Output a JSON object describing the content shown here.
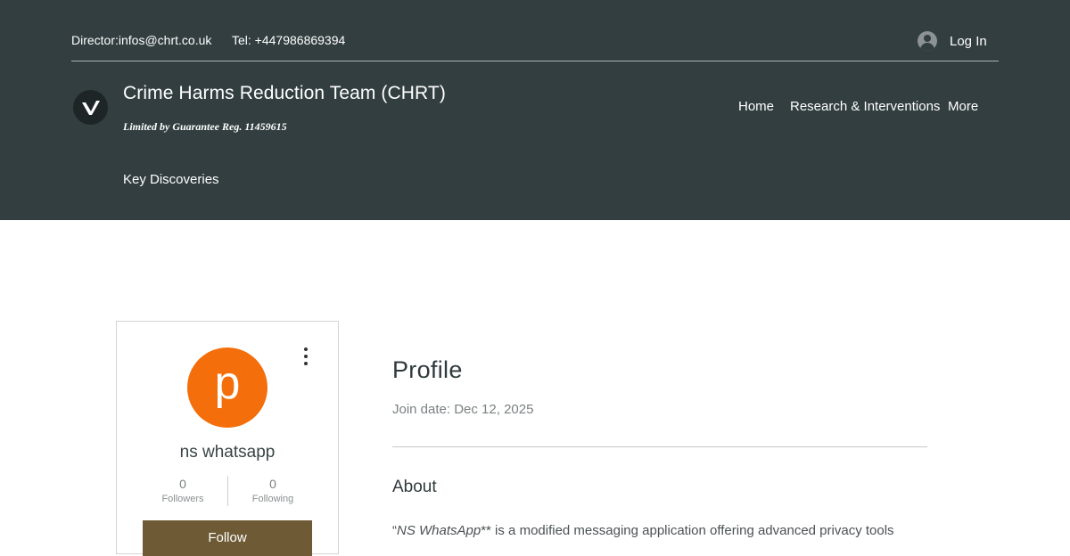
{
  "header": {
    "contact_email": "Director:infos@chrt.co.uk",
    "contact_phone": "Tel: +447986869394",
    "login_label": "Log In",
    "site_title": "Crime Harms Reduction Team (CHRT)",
    "tagline": "Limited by Guarantee Reg. 11459615",
    "nav": [
      "Home",
      "Research & Interventions",
      "More"
    ],
    "subnav": "Key Discoveries",
    "bg_color": "#323e40"
  },
  "profile_card": {
    "avatar_letter": "p",
    "avatar_color": "#f46e0b",
    "username": "ns whatsapp",
    "followers_count": "0",
    "followers_label": "Followers",
    "following_count": "0",
    "following_label": "Following",
    "follow_button": "Follow",
    "follow_button_color": "#6e5b35"
  },
  "profile": {
    "title": "Profile",
    "join_date": "Join date: Dec 12, 2025",
    "about_heading": "About",
    "about_text_italic": "NS WhatsApp",
    "about_text_rest": "** is a modified messaging application offering advanced privacy tools"
  }
}
